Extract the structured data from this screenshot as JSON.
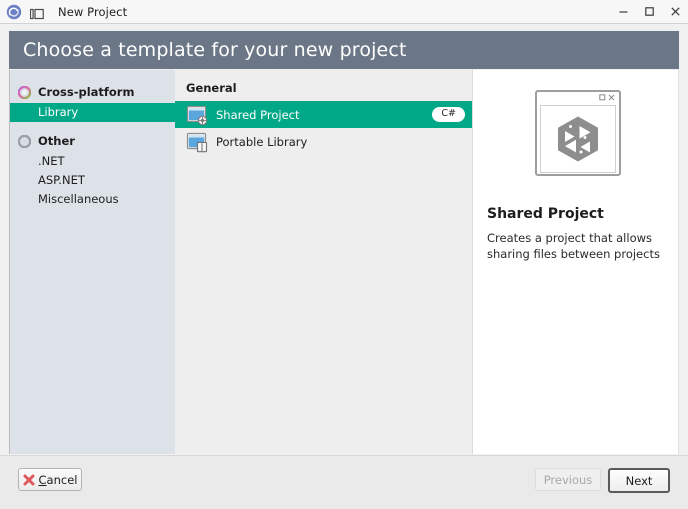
{
  "titlebar": {
    "app_icon": "monodevelop-app-icon",
    "pane_icon": "pane-layout-icon",
    "title": "New Project",
    "minimize_label": "Minimize",
    "maximize_label": "Maximize",
    "close_label": "Close"
  },
  "header": {
    "title": "Choose a template for your new project",
    "background": "#6b7786"
  },
  "sidebar": {
    "groups": [
      {
        "label": "Cross-platform",
        "icon": "cross-platform-ring-icon",
        "children": [
          {
            "label": "Library",
            "selected": true
          }
        ]
      },
      {
        "label": "Other",
        "icon": "other-ring-icon",
        "children": [
          {
            "label": ".NET",
            "selected": false
          },
          {
            "label": "ASP.NET",
            "selected": false
          },
          {
            "label": "Miscellaneous",
            "selected": false
          }
        ]
      }
    ],
    "selection_color": "#00a887",
    "background": "#dde2e8"
  },
  "list": {
    "section_title": "General",
    "templates": [
      {
        "name": "Shared Project",
        "icon": "shared-project-icon",
        "badge": "C#",
        "selected": true
      },
      {
        "name": "Portable Library",
        "icon": "portable-library-icon",
        "badge": "",
        "selected": false
      }
    ]
  },
  "preview": {
    "image_icon": "unity-cube-window-preview-icon",
    "title": "Shared Project",
    "description": "Creates a project that allows sharing files between projects"
  },
  "footer": {
    "cancel": {
      "prefix": "C",
      "rest": "ancel",
      "icon": "red-x-icon"
    },
    "previous": {
      "label": "Previous",
      "disabled": true
    },
    "next": {
      "label": "Next",
      "default": true
    }
  }
}
